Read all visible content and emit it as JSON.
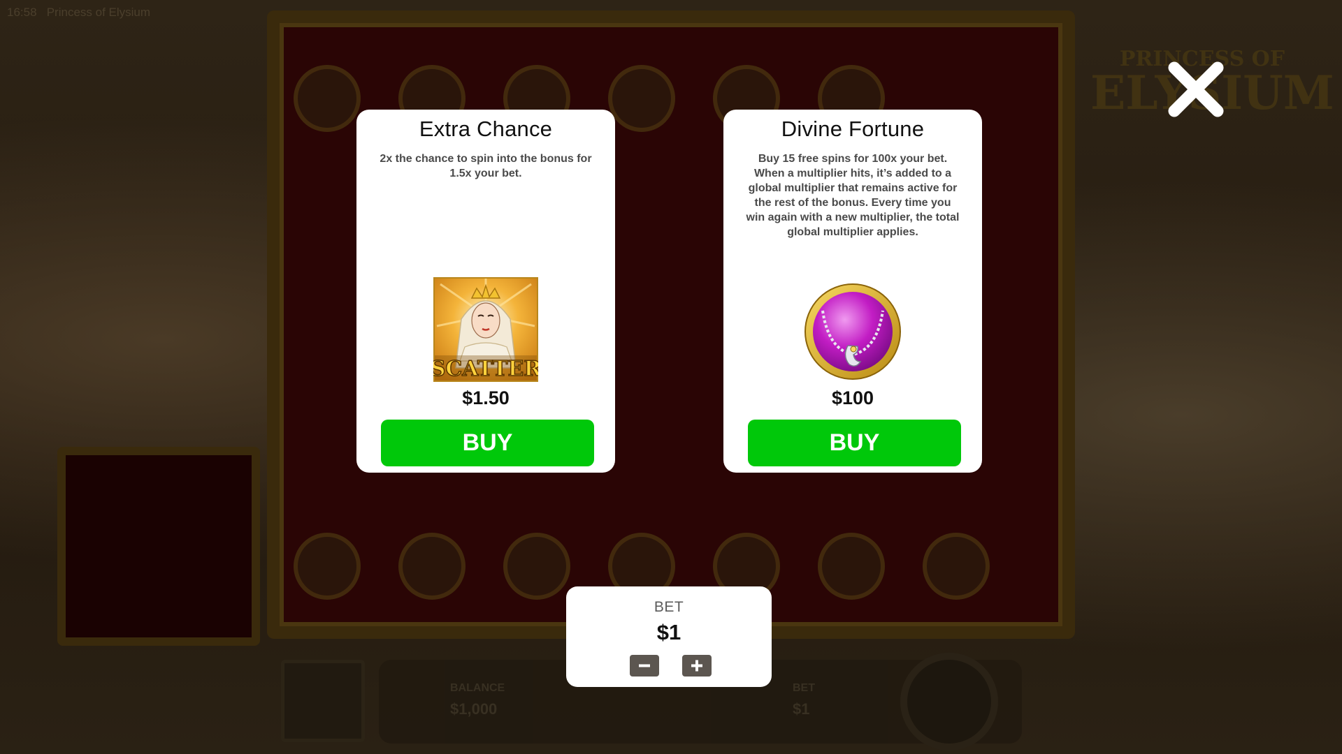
{
  "status_bar": {
    "time": "16:58",
    "game_name": "Princess of Elysium"
  },
  "background": {
    "logo_text_line1": "PRINCESS OF",
    "logo_text_line2": "ELYSIUM",
    "balance_label": "BALANCE",
    "balance_value": "$1,000",
    "bet_label": "BET",
    "bet_value": "$1"
  },
  "close_button": {
    "icon": "close-icon"
  },
  "cards": [
    {
      "title": "Extra Chance",
      "description": "2x the chance to spin into the bonus for 1.5x your bet.",
      "image_label": "SCATTER",
      "price": "$1.50",
      "buy_label": "BUY"
    },
    {
      "title": "Divine Fortune",
      "description": "Buy 15 free spins for 100x your bet. When a multiplier hits, it’s added to a global multiplier that remains active for the rest of the bonus. Every time you win again with a new multiplier, the total global multiplier applies.",
      "price": "$100",
      "buy_label": "BUY"
    }
  ],
  "bet_panel": {
    "label": "BET",
    "value": "$1",
    "minus_icon": "minus-icon",
    "plus_icon": "plus-icon"
  },
  "colors": {
    "buy_green": "#00c80a",
    "card_bg": "#ffffff",
    "overlay_dim": "#1c1408",
    "stepper_bg": "#5c5650"
  }
}
